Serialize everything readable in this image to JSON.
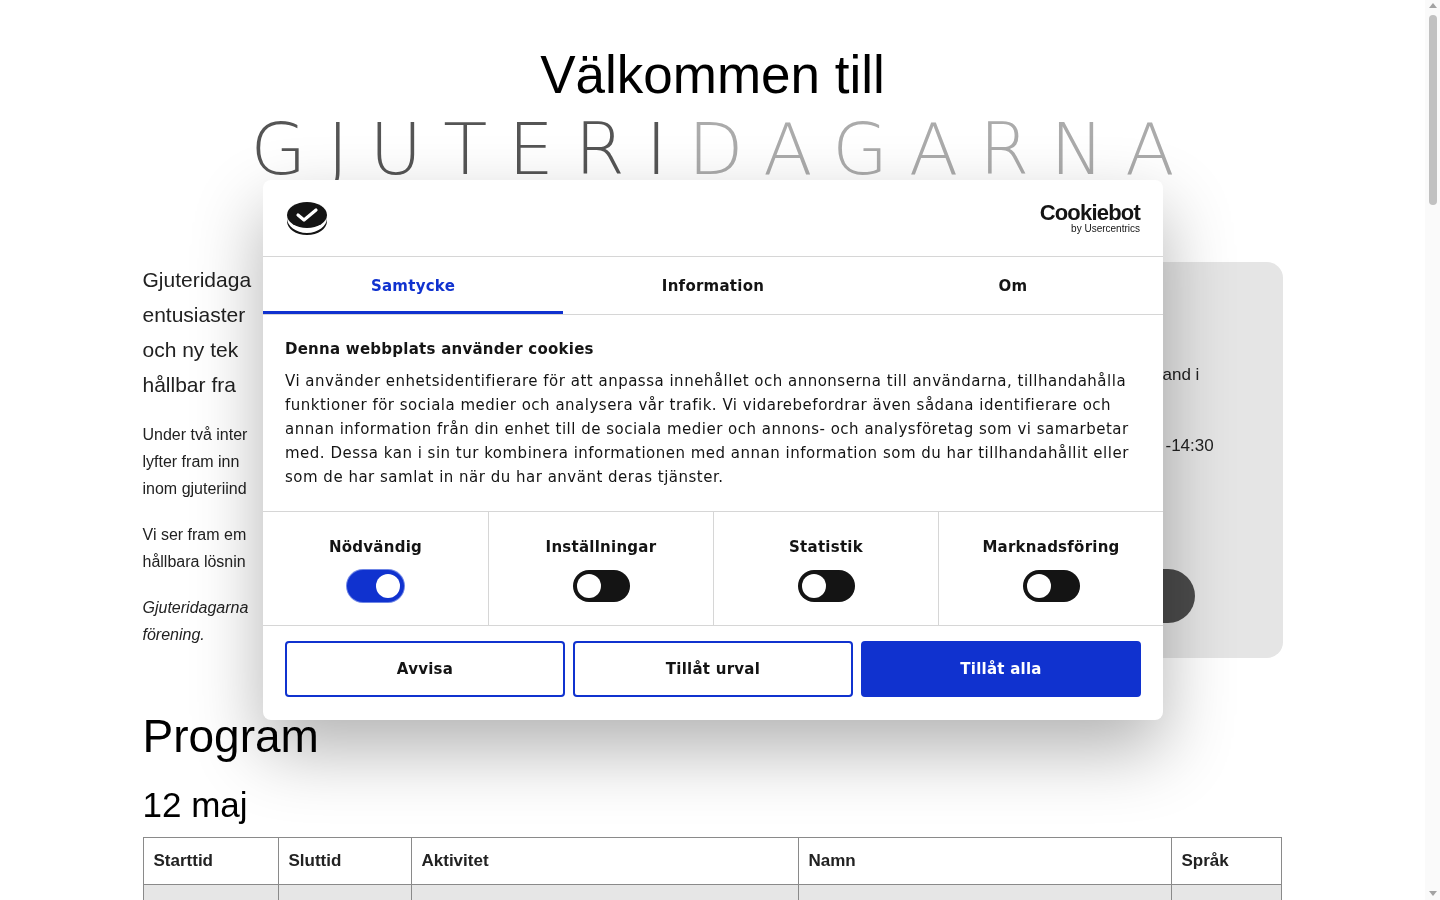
{
  "page": {
    "welcome": "Välkommen till",
    "logo": [
      {
        "text": "GJUTERI",
        "kind": "dark"
      },
      {
        "text": "DAGARNA",
        "kind": "light"
      }
    ],
    "intro": [
      {
        "kind": "lead",
        "lines": [
          "Gjuteridaga",
          "entusiaster",
          "och ny tek",
          "hållbar fra"
        ]
      },
      {
        "kind": "body",
        "lines": [
          "Under två inter",
          "lyfter fram inn",
          "inom gjuteriind"
        ]
      },
      {
        "kind": "body",
        "lines": [
          "Vi ser fram em",
          "hållbara lösnin"
        ]
      },
      {
        "kind": "note",
        "lines": [
          "Gjuteridagarna",
          "förening."
        ]
      }
    ],
    "info_card": {
      "lines": [
        "and i",
        "-14:30"
      ]
    },
    "program": {
      "title": "Program",
      "days": [
        {
          "date": "12 maj",
          "table": {
            "columns": [
              "Starttid",
              "Sluttid",
              "Aktivitet",
              "Namn",
              "Språk"
            ]
          }
        }
      ]
    }
  },
  "cookie_dialog": {
    "brand": {
      "name": "Cookiebot",
      "tagline": "by Usercentrics"
    },
    "tabs": [
      {
        "label": "Samtycke",
        "selected": true
      },
      {
        "label": "Information",
        "selected": false
      },
      {
        "label": "Om",
        "selected": false
      }
    ],
    "title": "Denna webbplats använder cookies",
    "text": "Vi använder enhetsidentifierare för att anpassa innehållet och annonserna till användarna, tillhandahålla funktioner för sociala medier och analysera vår trafik. Vi vidarebefordrar även sådana identifierare och annan information från din enhet till de sociala medier och annons- och analysföretag som vi samarbetar med. Dessa kan i sin tur kombinera informationen med annan information som du har tillhandahållit eller som de har samlat in när du har använt deras tjänster.",
    "categories": [
      {
        "label": "Nödvändig",
        "on": true
      },
      {
        "label": "Inställningar",
        "on": false
      },
      {
        "label": "Statistik",
        "on": false
      },
      {
        "label": "Marknadsföring",
        "on": false
      }
    ],
    "buttons": [
      {
        "label": "Avvisa",
        "kind": "outline"
      },
      {
        "label": "Tillåt urval",
        "kind": "outline"
      },
      {
        "label": "Tillåt alla",
        "kind": "primary"
      }
    ]
  }
}
